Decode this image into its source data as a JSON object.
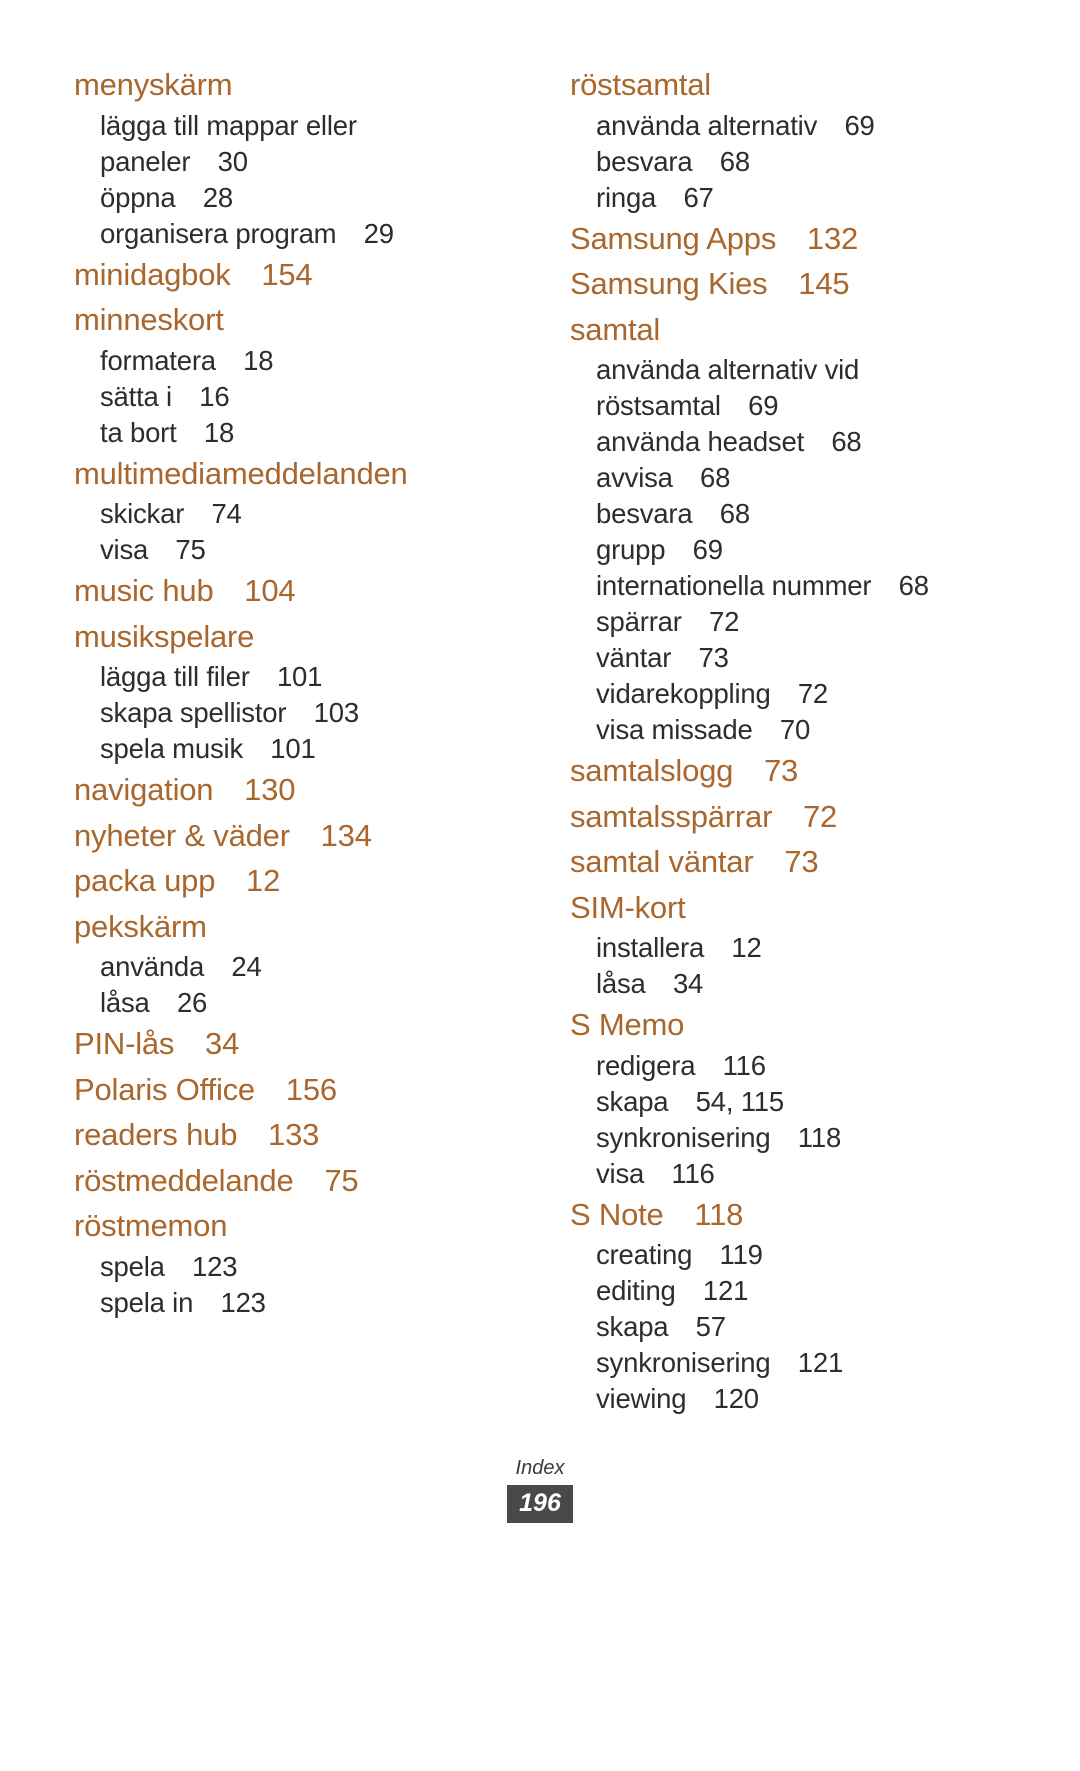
{
  "document": {
    "type": "index-page",
    "footer_label": "Index",
    "page_number": "196",
    "accent_color": "#a9672e",
    "body_color": "#2e2c2c",
    "badge_color": "#4a4947"
  },
  "columns": [
    {
      "id": "left",
      "entries": [
        {
          "head": "menyskärm",
          "page": "",
          "subs": [
            {
              "label": "lägga till mappar eller",
              "page": ""
            },
            {
              "label": "paneler",
              "page": "30"
            },
            {
              "label": "öppna",
              "page": "28"
            },
            {
              "label": "organisera program",
              "page": "29"
            }
          ]
        },
        {
          "head": "minidagbok",
          "page": "154",
          "subs": []
        },
        {
          "head": "minneskort",
          "page": "",
          "subs": [
            {
              "label": "formatera",
              "page": "18"
            },
            {
              "label": "sätta i",
              "page": "16"
            },
            {
              "label": "ta bort",
              "page": "18"
            }
          ]
        },
        {
          "head": "multimediameddelanden",
          "page": "",
          "subs": [
            {
              "label": "skickar",
              "page": "74"
            },
            {
              "label": "visa",
              "page": "75"
            }
          ]
        },
        {
          "head": "music hub",
          "page": "104",
          "subs": []
        },
        {
          "head": "musikspelare",
          "page": "",
          "subs": [
            {
              "label": "lägga till filer",
              "page": "101"
            },
            {
              "label": "skapa spellistor",
              "page": "103"
            },
            {
              "label": "spela musik",
              "page": "101"
            }
          ]
        },
        {
          "head": "navigation",
          "page": "130",
          "subs": []
        },
        {
          "head": "nyheter & väder",
          "page": "134",
          "subs": []
        },
        {
          "head": "packa upp",
          "page": "12",
          "subs": []
        },
        {
          "head": "pekskärm",
          "page": "",
          "subs": [
            {
              "label": "använda",
              "page": "24"
            },
            {
              "label": "låsa",
              "page": "26"
            }
          ]
        },
        {
          "head": "PIN-lås",
          "page": "34",
          "subs": []
        },
        {
          "head": "Polaris Office",
          "page": "156",
          "subs": []
        },
        {
          "head": "readers hub",
          "page": "133",
          "subs": []
        },
        {
          "head": "röstmeddelande",
          "page": "75",
          "subs": []
        },
        {
          "head": "röstmemon",
          "page": "",
          "subs": [
            {
              "label": "spela",
              "page": "123"
            },
            {
              "label": "spela in",
              "page": "123"
            }
          ]
        }
      ]
    },
    {
      "id": "right",
      "entries": [
        {
          "head": "röstsamtal",
          "page": "",
          "subs": [
            {
              "label": "använda alternativ",
              "page": "69"
            },
            {
              "label": "besvara",
              "page": "68"
            },
            {
              "label": "ringa",
              "page": "67"
            }
          ]
        },
        {
          "head": "Samsung Apps",
          "page": "132",
          "subs": []
        },
        {
          "head": "Samsung Kies",
          "page": "145",
          "subs": []
        },
        {
          "head": "samtal",
          "page": "",
          "subs": [
            {
              "label": "använda alternativ vid",
              "page": ""
            },
            {
              "label": "röstsamtal",
              "page": "69"
            },
            {
              "label": "använda headset",
              "page": "68"
            },
            {
              "label": "avvisa",
              "page": "68"
            },
            {
              "label": "besvara",
              "page": "68"
            },
            {
              "label": "grupp",
              "page": "69"
            },
            {
              "label": "internationella nummer",
              "page": "68"
            },
            {
              "label": "spärrar",
              "page": "72"
            },
            {
              "label": "väntar",
              "page": "73"
            },
            {
              "label": "vidarekoppling",
              "page": "72"
            },
            {
              "label": "visa missade",
              "page": "70"
            }
          ]
        },
        {
          "head": "samtalslogg",
          "page": "73",
          "subs": []
        },
        {
          "head": "samtalsspärrar",
          "page": "72",
          "subs": []
        },
        {
          "head": "samtal väntar",
          "page": "73",
          "subs": []
        },
        {
          "head": "SIM-kort",
          "page": "",
          "subs": [
            {
              "label": "installera",
              "page": "12"
            },
            {
              "label": "låsa",
              "page": "34"
            }
          ]
        },
        {
          "head": "S Memo",
          "page": "",
          "subs": [
            {
              "label": "redigera",
              "page": "116"
            },
            {
              "label": "skapa",
              "page": "54, 115"
            },
            {
              "label": "synkronisering",
              "page": "118"
            },
            {
              "label": "visa",
              "page": "116"
            }
          ]
        },
        {
          "head": "S Note",
          "page": "118",
          "subs": [
            {
              "label": "creating",
              "page": "119"
            },
            {
              "label": "editing",
              "page": "121"
            },
            {
              "label": "skapa",
              "page": "57"
            },
            {
              "label": "synkronisering",
              "page": "121"
            },
            {
              "label": "viewing",
              "page": "120"
            }
          ]
        }
      ]
    }
  ]
}
